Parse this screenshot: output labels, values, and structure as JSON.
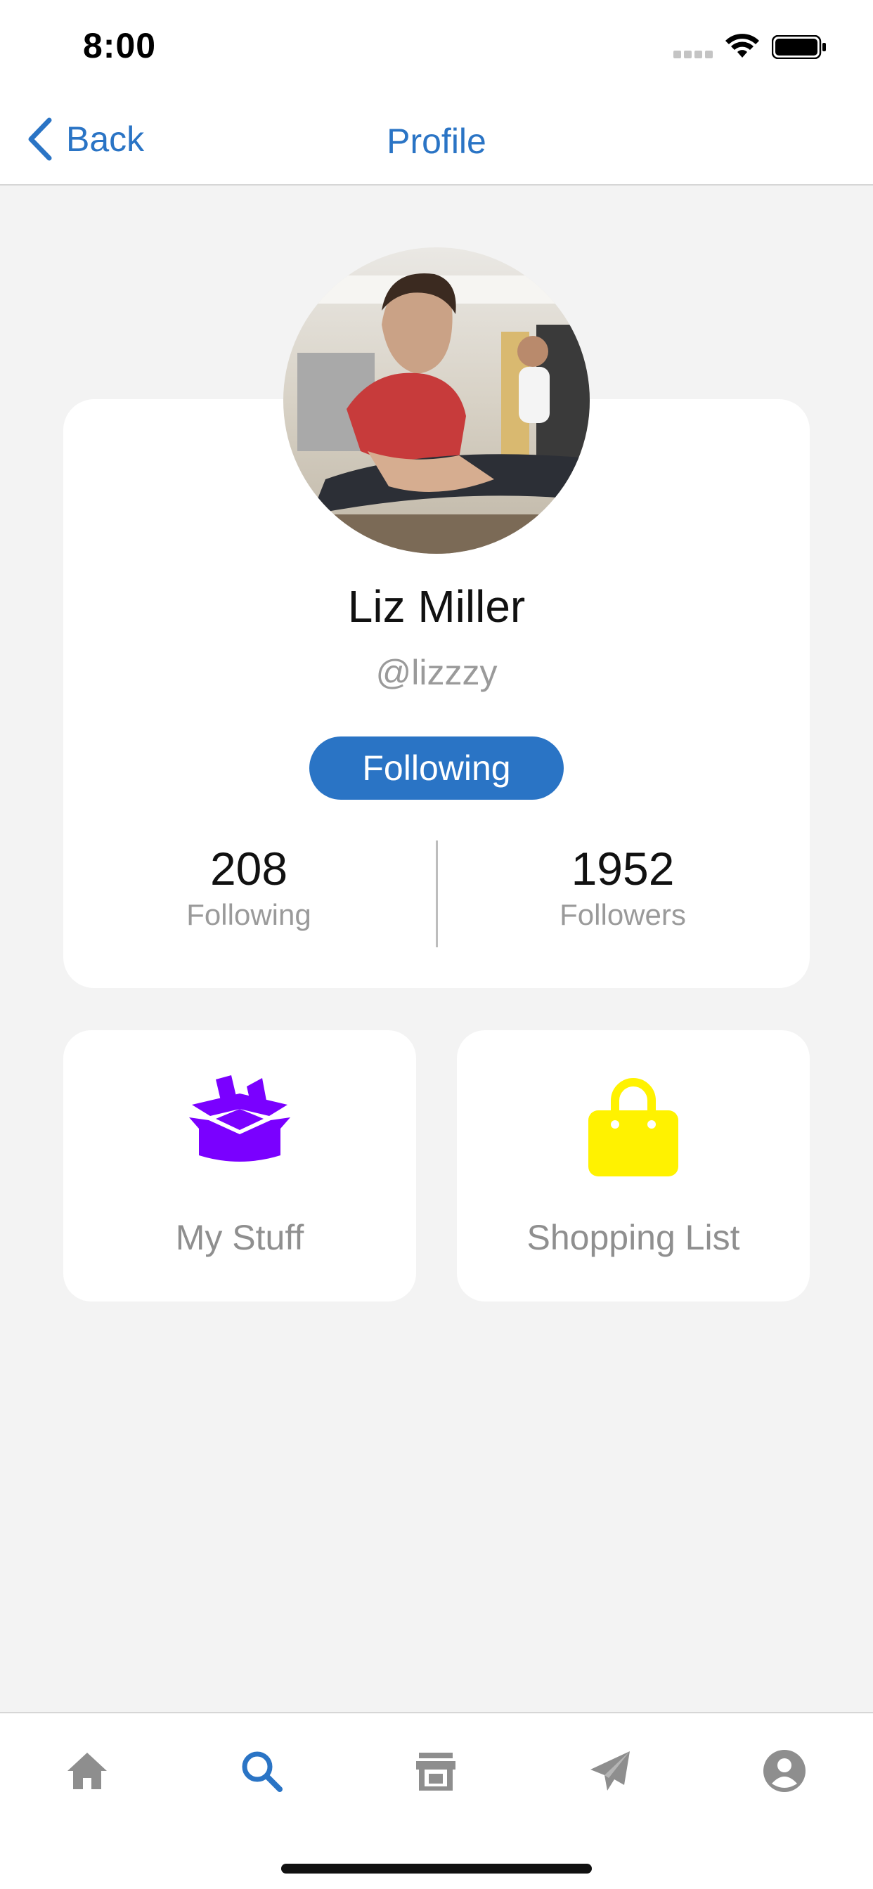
{
  "status_bar": {
    "time": "8:00"
  },
  "nav": {
    "back_label": "Back",
    "title": "Profile"
  },
  "profile": {
    "name": "Liz Miller",
    "handle": "@lizzzy",
    "follow_button_label": "Following",
    "stats": {
      "following_count": "208",
      "following_label": "Following",
      "followers_count": "1952",
      "followers_label": "Followers"
    }
  },
  "tiles": [
    {
      "label": "My Stuff",
      "icon": "open-box-icon",
      "color": "#7a00ff"
    },
    {
      "label": "Shopping List",
      "icon": "shopping-bag-icon",
      "color": "#fff200"
    }
  ],
  "tab_bar": {
    "items": [
      {
        "icon": "home-icon",
        "active": false
      },
      {
        "icon": "search-icon",
        "active": true
      },
      {
        "icon": "store-icon",
        "active": false
      },
      {
        "icon": "send-icon",
        "active": false
      },
      {
        "icon": "account-icon",
        "active": false
      }
    ],
    "active_color": "#2a74c5",
    "inactive_color": "#8e8e8e"
  },
  "colors": {
    "accent": "#2a74c5",
    "background": "#f3f3f3"
  }
}
